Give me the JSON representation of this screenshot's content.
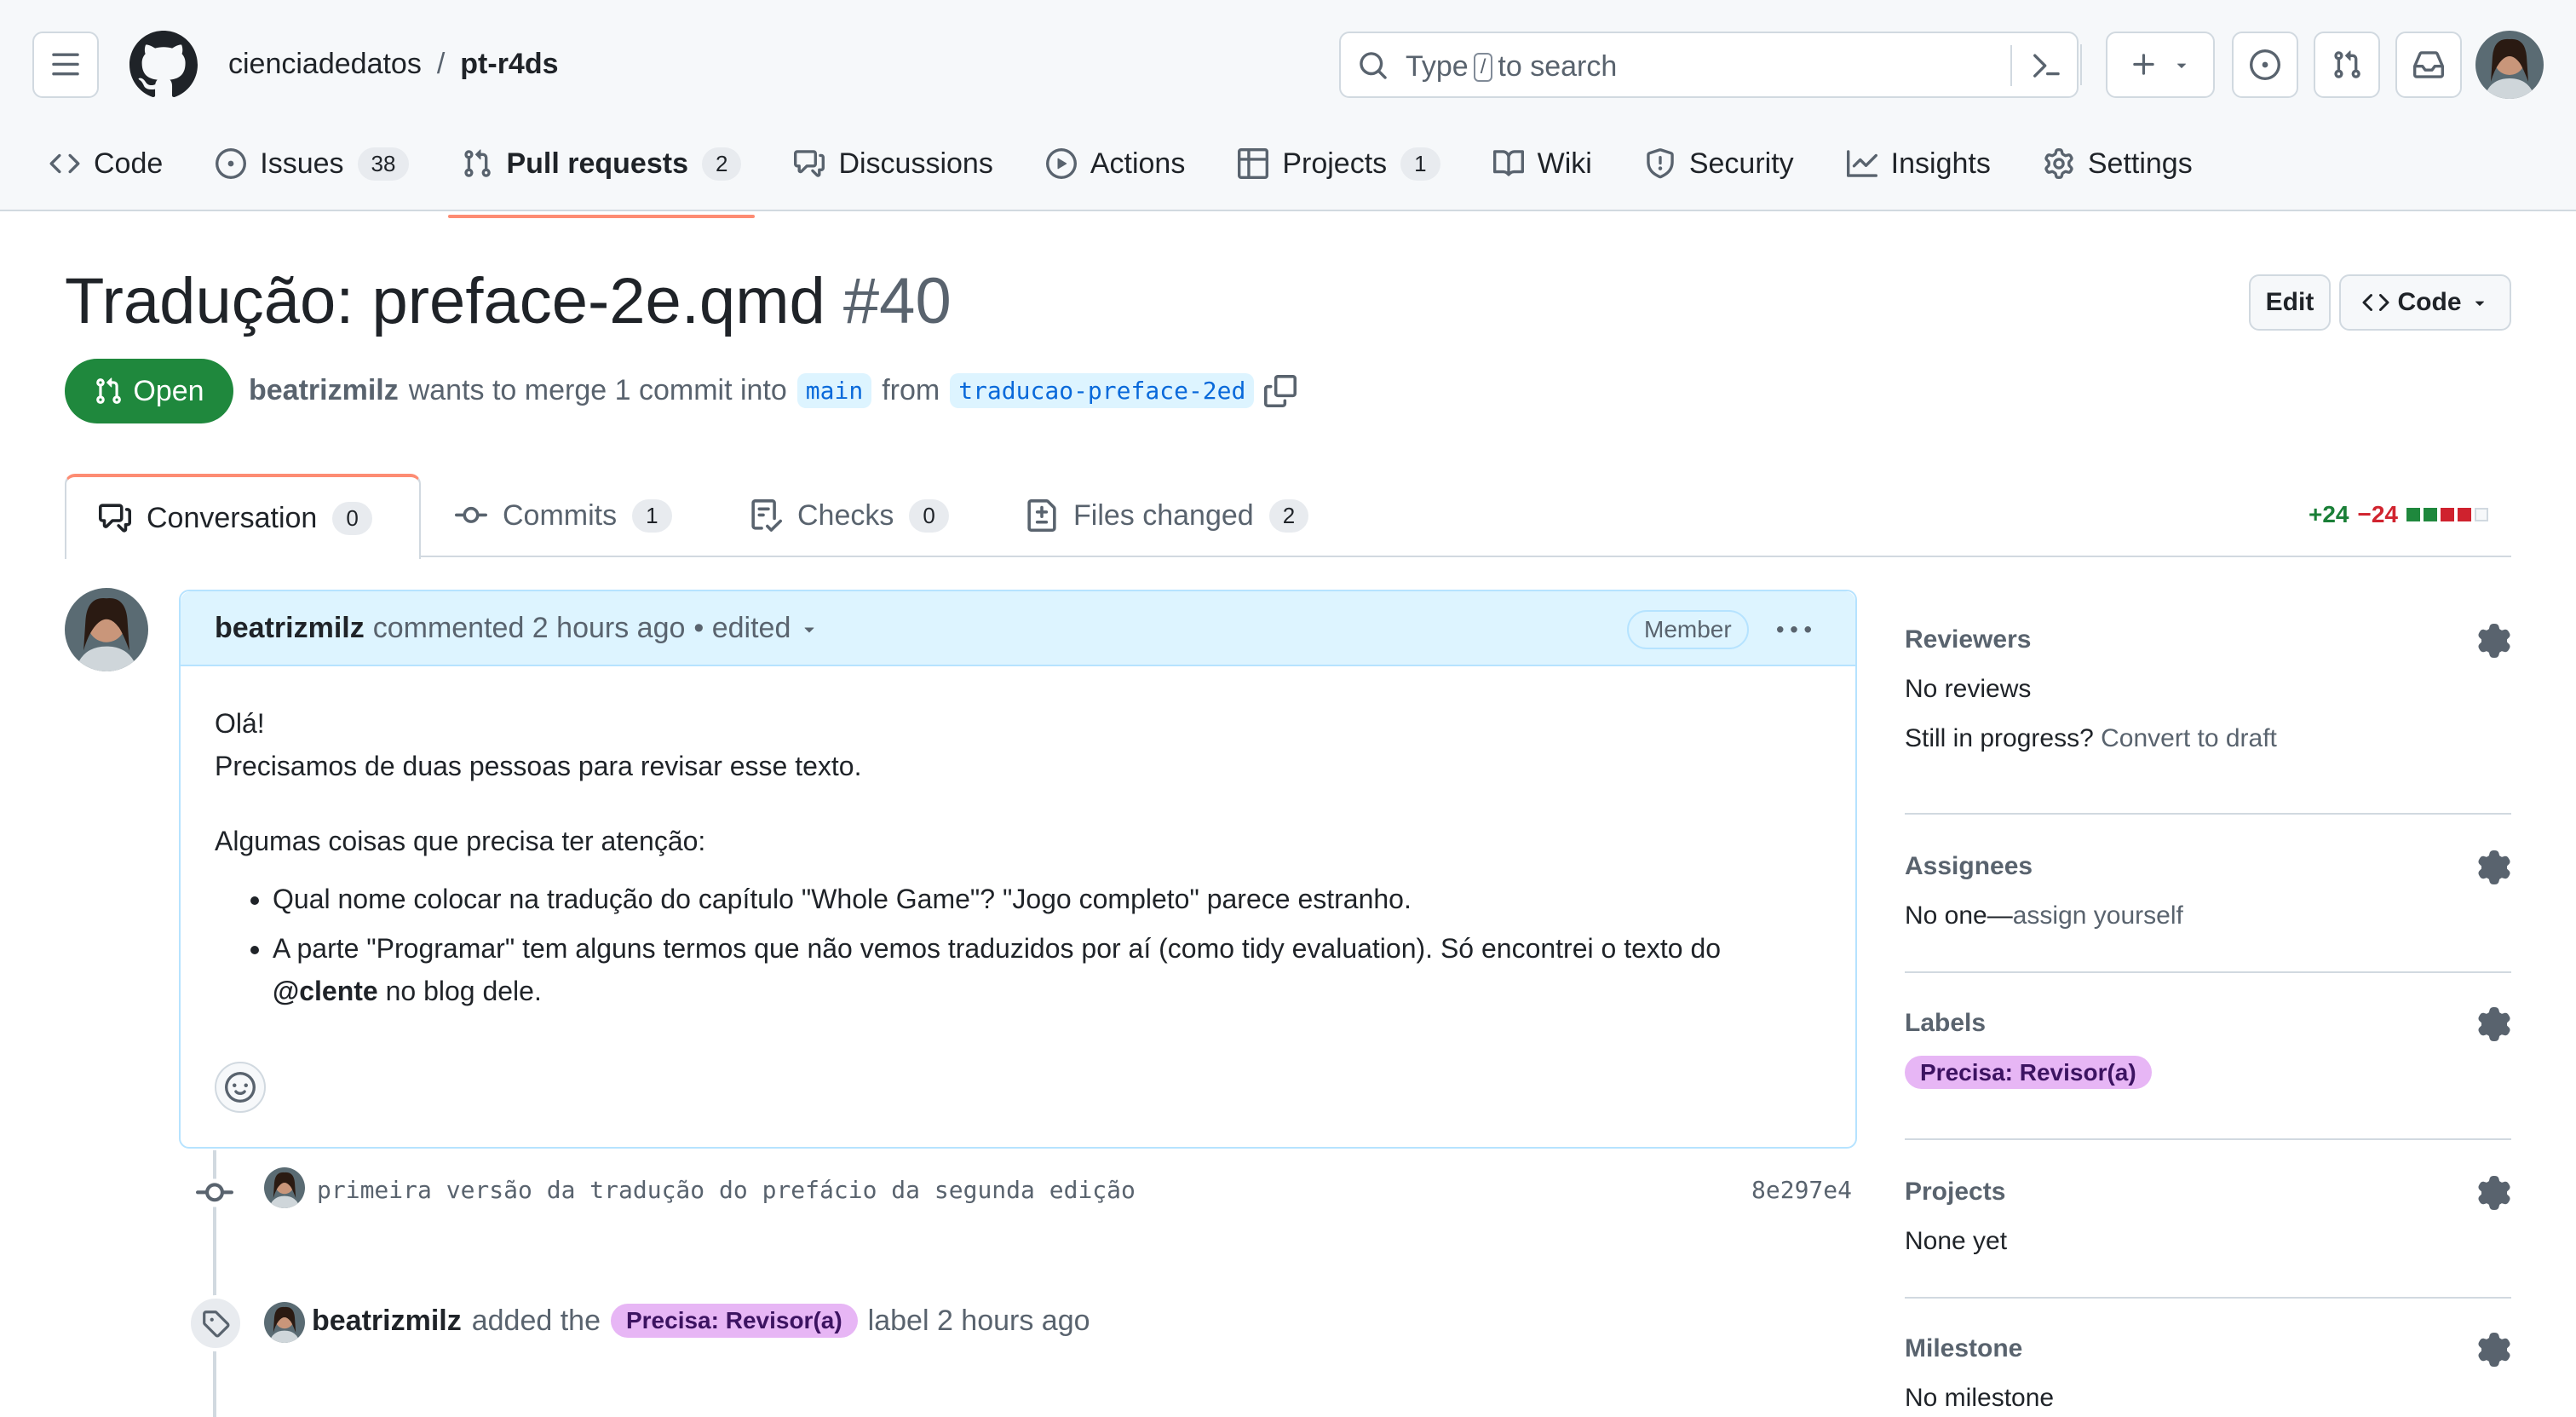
{
  "header": {
    "owner": "cienciadedatos",
    "separator": "/",
    "repo": "pt-r4ds",
    "search_prefix": "Type",
    "search_key": "/",
    "search_suffix": "to search"
  },
  "repo_nav": {
    "code": "Code",
    "issues": "Issues",
    "issues_count": "38",
    "pulls": "Pull requests",
    "pulls_count": "2",
    "discussions": "Discussions",
    "actions": "Actions",
    "projects": "Projects",
    "projects_count": "1",
    "wiki": "Wiki",
    "security": "Security",
    "insights": "Insights",
    "settings": "Settings"
  },
  "pr": {
    "title": "Tradução: preface-2e.qmd",
    "number": "#40",
    "edit_label": "Edit",
    "code_label": "Code",
    "state": "Open",
    "author": "beatrizmilz",
    "merge_text": "wants to merge 1 commit into",
    "base_branch": "main",
    "from_text": "from",
    "head_branch": "traducao-preface-2ed"
  },
  "tabs": {
    "conversation": "Conversation",
    "conversation_count": "0",
    "commits": "Commits",
    "commits_count": "1",
    "checks": "Checks",
    "checks_count": "0",
    "files": "Files changed",
    "files_count": "2",
    "additions": "+24",
    "deletions": "−24"
  },
  "comment": {
    "author": "beatrizmilz",
    "action": "commented 2 hours ago",
    "edited": "• edited",
    "role": "Member",
    "line1": "Olá!",
    "line2": "Precisamos de duas pessoas para revisar esse texto.",
    "line3": "Algumas coisas que precisa ter atenção:",
    "bullet1": "Qual nome colocar na tradução do capítulo \"Whole Game\"? \"Jogo completo\" parece estranho.",
    "bullet2_pre": "A parte \"Programar\" tem alguns termos que não vemos traduzidos por aí (como tidy evaluation). Só encontrei o texto do",
    "bullet2_mention": "@clente",
    "bullet2_post": "no blog dele."
  },
  "timeline": {
    "commit_message": "primeira versão da tradução do prefácio da segunda edição",
    "commit_sha": "8e297e4",
    "event_author": "beatrizmilz",
    "event_action": "added the",
    "event_label": "Precisa: Revisor(a)",
    "event_suffix": "label 2 hours ago"
  },
  "sidebar": {
    "reviewers_title": "Reviewers",
    "reviewers_value": "No reviews",
    "draft_prefix": "Still in progress?",
    "draft_link": "Convert to draft",
    "assignees_title": "Assignees",
    "assignees_prefix": "No one—",
    "assignees_link": "assign yourself",
    "labels_title": "Labels",
    "label": "Precisa: Revisor(a)",
    "projects_title": "Projects",
    "projects_value": "None yet",
    "milestone_title": "Milestone",
    "milestone_value": "No milestone"
  },
  "colors": {
    "open_green": "#1f883d",
    "active_tab_underline": "#fd8c73",
    "label_bg": "#e7b6f5",
    "link_blue": "#0969da"
  },
  "icons": [
    "hamburger-icon",
    "github-logo",
    "search-icon",
    "command-palette-icon",
    "plus-icon",
    "issues-icon",
    "pull-request-icon",
    "inbox-icon",
    "code-icon",
    "play-icon",
    "table-icon",
    "book-icon",
    "shield-icon",
    "graph-icon",
    "gear-icon",
    "copy-icon",
    "comment-icon",
    "commit-icon",
    "checklist-icon",
    "file-diff-icon",
    "kebab-icon",
    "smiley-icon",
    "tag-icon"
  ]
}
